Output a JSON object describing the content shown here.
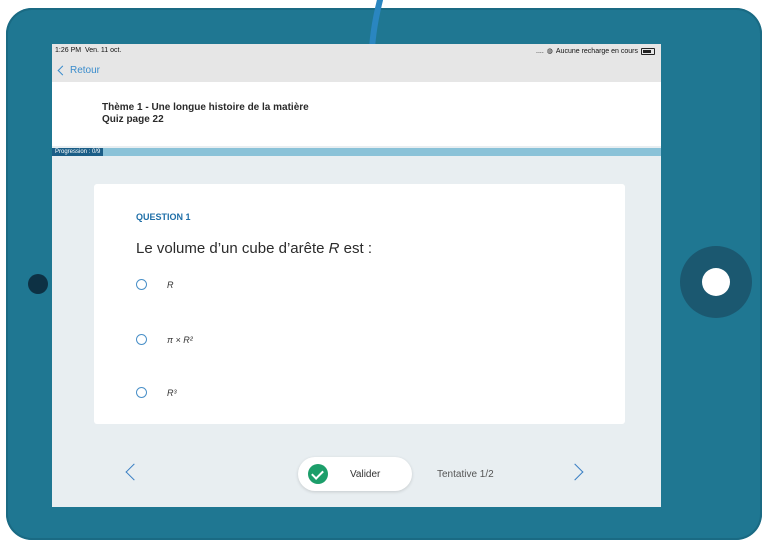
{
  "statusbar": {
    "time": "1:26 PM",
    "date": "Ven. 11 oct.",
    "signal": "....",
    "charging": "Aucune recharge en cours",
    "wifi_icon": "wifi-icon",
    "battery_icon": "battery-icon"
  },
  "nav": {
    "back_label": "Retour"
  },
  "header": {
    "theme_title": "Thème 1 - Une longue histoire de la matière",
    "quiz_title": "Quiz page 22"
  },
  "progress": {
    "label": "Progression : 0/9",
    "value": 0,
    "total": 9
  },
  "question": {
    "label": "QUESTION 1",
    "text_before": "Le volume d’un cube d’arête ",
    "variable": "R",
    "text_after": " est :",
    "options": [
      {
        "label": "R"
      },
      {
        "label": "π × R²"
      },
      {
        "label": "R³"
      }
    ]
  },
  "footer": {
    "validate_label": "Valider",
    "attempt_label": "Tentative 1/2"
  },
  "colors": {
    "frame": "#1f7792",
    "accent": "#1f6fa8",
    "validate_check": "#1c9e6a",
    "progress_bar": "#8ac2d8",
    "arrow": "#2a86c0"
  }
}
